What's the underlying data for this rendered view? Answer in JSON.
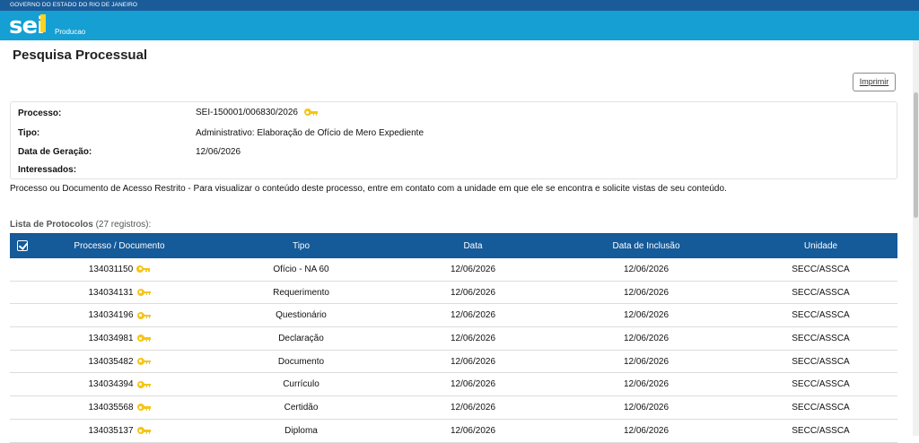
{
  "header": {
    "government": "GOVERNO DO ESTADO DO RIO DE JANEIRO",
    "logo_text": "sei",
    "system": "Producao"
  },
  "page": {
    "title": "Pesquisa Processual",
    "print_label": "Imprimir"
  },
  "process": {
    "label_processo": "Processo:",
    "numero": "SEI-150001/006830/2026",
    "label_tipo": "Tipo:",
    "tipo": "Administrativo: Elaboração de Ofício de Mero Expediente",
    "label_data": "Data de Geração:",
    "data_geracao": "12/06/2026",
    "label_interessados": "Interessados:"
  },
  "notice": "Processo ou Documento de Acesso Restrito - Para visualizar o conteúdo deste processo, entre em contato com a unidade em que ele se encontra e solicite vistas de seu conteúdo.",
  "list": {
    "caption": "Lista de Protocolos",
    "count": "(27 registros):",
    "columns": [
      "Processo / Documento",
      "Tipo",
      "Data",
      "Data de Inclusão",
      "Unidade"
    ],
    "rows": [
      {
        "doc": "134031150",
        "tipo": "Ofício - NA 60",
        "data": "12/06/2026",
        "inclusao": "12/06/2026",
        "unidade": "SECC/ASSCA"
      },
      {
        "doc": "134034131",
        "tipo": "Requerimento",
        "data": "12/06/2026",
        "inclusao": "12/06/2026",
        "unidade": "SECC/ASSCA"
      },
      {
        "doc": "134034196",
        "tipo": "Questionário",
        "data": "12/06/2026",
        "inclusao": "12/06/2026",
        "unidade": "SECC/ASSCA"
      },
      {
        "doc": "134034981",
        "tipo": "Declaração",
        "data": "12/06/2026",
        "inclusao": "12/06/2026",
        "unidade": "SECC/ASSCA"
      },
      {
        "doc": "134035482",
        "tipo": "Documento",
        "data": "12/06/2026",
        "inclusao": "12/06/2026",
        "unidade": "SECC/ASSCA"
      },
      {
        "doc": "134034394",
        "tipo": "Currículo",
        "data": "12/06/2026",
        "inclusao": "12/06/2026",
        "unidade": "SECC/ASSCA"
      },
      {
        "doc": "134035568",
        "tipo": "Certidão",
        "data": "12/06/2026",
        "inclusao": "12/06/2026",
        "unidade": "SECC/ASSCA"
      },
      {
        "doc": "134035137",
        "tipo": "Diploma",
        "data": "12/06/2026",
        "inclusao": "12/06/2026",
        "unidade": "SECC/ASSCA"
      }
    ]
  },
  "icons": {
    "key": "key-icon",
    "checkbox": "checkbox-icon"
  },
  "colors": {
    "topbar": "#1a5c99",
    "brandbar": "#159fd3",
    "table_header": "#155a99",
    "key": "#f5c518"
  }
}
